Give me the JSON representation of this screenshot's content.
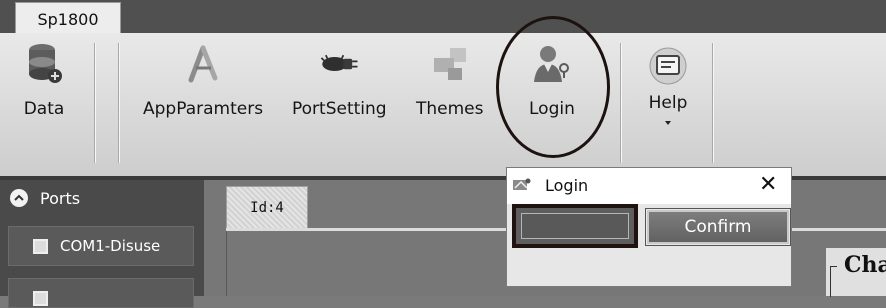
{
  "app": {
    "tab_label": "Sp1800"
  },
  "ribbon": {
    "buttons": [
      {
        "label": "Data",
        "icon": "database-icon"
      },
      {
        "label": "AppParamters",
        "icon": "compass-tools-icon"
      },
      {
        "label": "PortSetting",
        "icon": "cable-plug-icon"
      },
      {
        "label": "Themes",
        "icon": "blocks-icon"
      },
      {
        "label": "Login",
        "icon": "user-key-icon"
      },
      {
        "label": "Help",
        "icon": "help-window-icon"
      }
    ]
  },
  "sidebar": {
    "header": "Ports",
    "ports": [
      {
        "label": "COM1-Disuse"
      }
    ]
  },
  "document": {
    "tab_label": "Id:4",
    "partial_heading": "Cha"
  },
  "login_dialog": {
    "title": "Login",
    "close_glyph": "✕",
    "password_value": "",
    "confirm_label": "Confirm"
  },
  "colors": {
    "annotation": "#1c1210"
  }
}
